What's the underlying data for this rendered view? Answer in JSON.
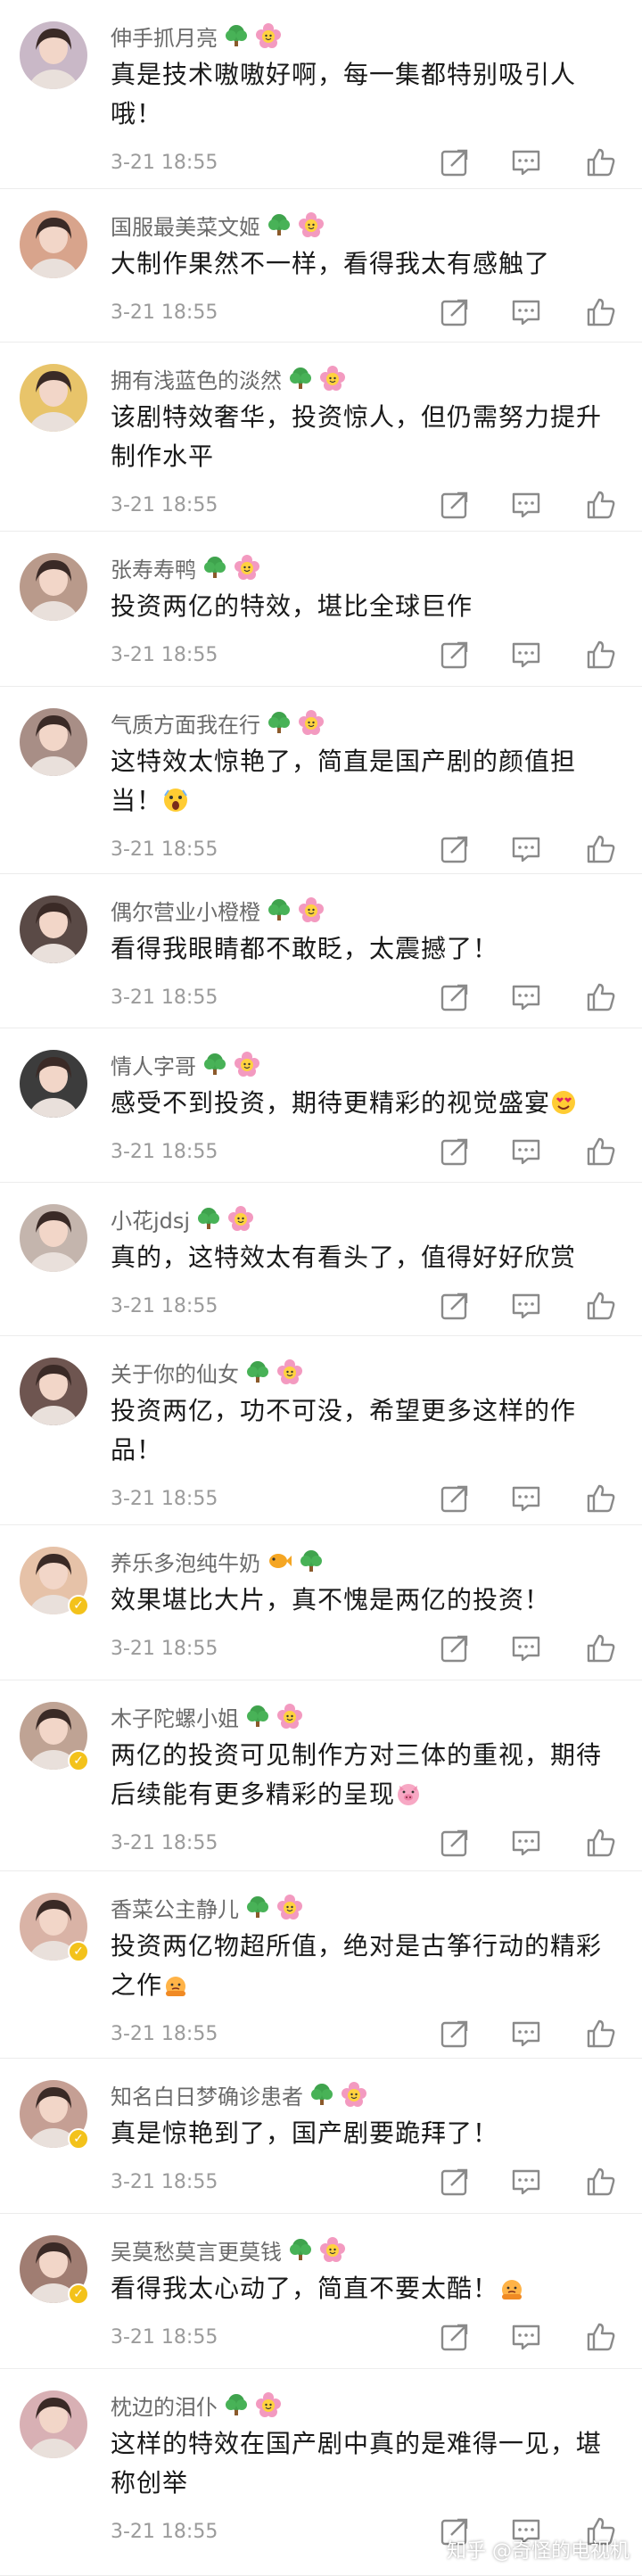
{
  "comments": [
    {
      "name": "伸手抓月亮",
      "text": "真是技术嗷嗷好啊，每一集都特别吸引人哦！",
      "time": "3-21 18:55",
      "verified": false,
      "avatar_color": "#c9b8c7",
      "text_emoji": ""
    },
    {
      "name": "国服最美菜文姬",
      "text": "大制作果然不一样，看得我太有感触了",
      "time": "3-21 18:55",
      "verified": false,
      "avatar_color": "#d8a48c",
      "text_emoji": ""
    },
    {
      "name": "拥有浅蓝色的淡然",
      "text": "该剧特效奢华，投资惊人，但仍需努力提升制作水平",
      "time": "3-21 18:55",
      "verified": false,
      "avatar_color": "#e8c46a",
      "text_emoji": ""
    },
    {
      "name": "张寿寿鸭",
      "text": "投资两亿的特效，堪比全球巨作",
      "time": "3-21 18:55",
      "verified": false,
      "avatar_color": "#b99a8b",
      "text_emoji": ""
    },
    {
      "name": "气质方面我在行",
      "text": "这特效太惊艳了，简直是国产剧的颜值担当！",
      "time": "3-21 18:55",
      "verified": false,
      "avatar_color": "#a88e86",
      "text_emoji": "scream"
    },
    {
      "name": "偶尔营业小橙橙",
      "text": "看得我眼睛都不敢眨，太震撼了！",
      "time": "3-21 18:55",
      "verified": false,
      "avatar_color": "#5a4a46",
      "text_emoji": ""
    },
    {
      "name": "情人字哥",
      "text": "感受不到投资，期待更精彩的视觉盛宴",
      "time": "3-21 18:55",
      "verified": false,
      "avatar_color": "#3c3c3c",
      "text_emoji": "love"
    },
    {
      "name": "小花jdsj",
      "text": "真的，这特效太有看头了，值得好好欣赏",
      "time": "3-21 18:55",
      "verified": false,
      "avatar_color": "#c4b5ad",
      "text_emoji": ""
    },
    {
      "name": "关于你的仙女",
      "text": "投资两亿，功不可没，希望更多这样的作品！",
      "time": "3-21 18:55",
      "verified": false,
      "avatar_color": "#6e5550",
      "text_emoji": ""
    },
    {
      "name": "养乐多泡纯牛奶",
      "text": "效果堪比大片，真不愧是两亿的投资！",
      "time": "3-21 18:55",
      "verified": true,
      "avatar_color": "#e6c2a8",
      "text_emoji": ""
    },
    {
      "name": "木子陀螺小姐",
      "text": "两亿的投资可见制作方对三体的重视，期待后续能有更多精彩的呈现",
      "time": "3-21 18:55",
      "verified": true,
      "avatar_color": "#bfa394",
      "text_emoji": "pig"
    },
    {
      "name": "香菜公主静儿",
      "text": "投资两亿物超所值，绝对是古筝行动的精彩之作",
      "time": "3-21 18:55",
      "verified": true,
      "avatar_color": "#d9b3a6",
      "text_emoji": "bow"
    },
    {
      "name": "知名白日梦确诊患者",
      "text": "真是惊艳到了，国产剧要跪拜了！",
      "time": "3-21 18:55",
      "verified": true,
      "avatar_color": "#c59f94",
      "text_emoji": ""
    },
    {
      "name": "吴莫愁莫言更莫钱",
      "text": "看得我太心动了，简直不要太酷！",
      "time": "3-21 18:55",
      "verified": true,
      "avatar_color": "#a07d72",
      "text_emoji": "bow"
    },
    {
      "name": "枕边的泪仆",
      "text": "这样的特效在国产剧中真的是难得一见，堪称创举",
      "time": "3-21 18:55",
      "verified": false,
      "avatar_color": "#d8b0b4",
      "text_emoji": ""
    }
  ],
  "icons": {
    "forward": "forward-icon",
    "comment": "comment-icon",
    "like": "thumbs-up-icon",
    "tree_badge": "tree-badge-icon",
    "flower_badge": "flower-badge-icon"
  },
  "colors": {
    "text": "#1a1a1a",
    "name": "#6b6b6b",
    "time": "#9b9b9b",
    "icon": "#8a8a8a",
    "vip": "#f3c21b"
  },
  "watermark": "知乎 @奇怪的电视机"
}
